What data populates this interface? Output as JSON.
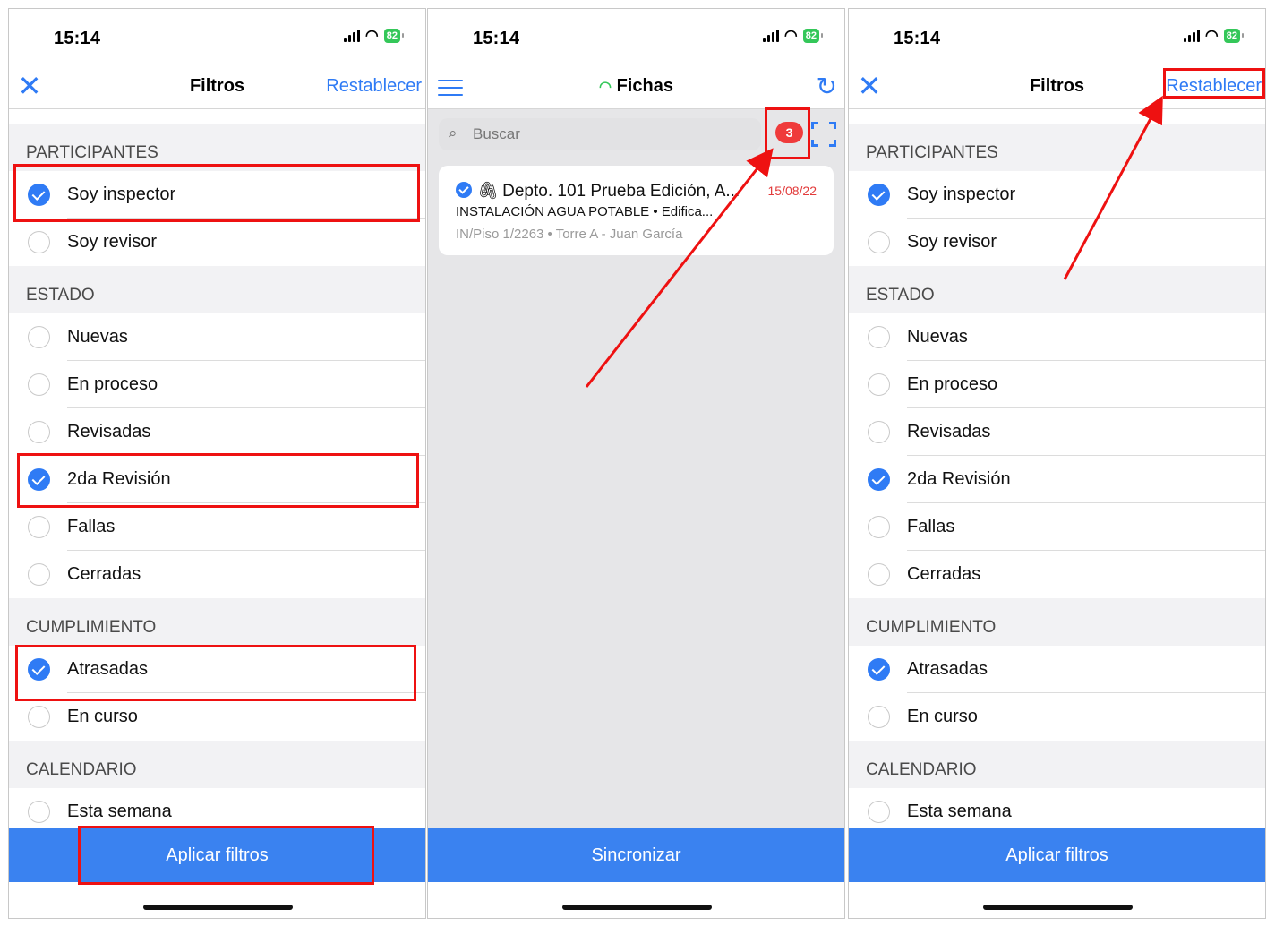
{
  "status_bar": {
    "time": "15:14",
    "battery": "82"
  },
  "filters_screen": {
    "close_icon": "close-icon",
    "title": "Filtros",
    "reset_label": "Restablecer",
    "sections": {
      "participants": "PARTICIPANTES",
      "state": "ESTADO",
      "compliance": "CUMPLIMIENTO",
      "calendar": "CALENDARIO"
    },
    "options": {
      "inspector": "Soy inspector",
      "reviewer": "Soy revisor",
      "new": "Nuevas",
      "in_process": "En proceso",
      "reviewed": "Revisadas",
      "second_review": "2da Revisión",
      "failures": "Fallas",
      "closed": "Cerradas",
      "overdue": "Atrasadas",
      "ongoing": "En curso",
      "this_week": "Esta semana"
    },
    "apply_label": "Aplicar filtros"
  },
  "list_screen": {
    "menu_icon": "menu-icon",
    "wifi_icon": "wifi-icon",
    "title": "Fichas",
    "sync_icon": "sync-icon",
    "search_placeholder": "Buscar",
    "filter_count": "3",
    "scan_icon": "scan-icon",
    "card": {
      "title": "Depto. 101 Prueba Edición, A...",
      "date": "15/08/22",
      "subtitle": "INSTALACIÓN AGUA POTABLE • Edifica...",
      "meta": "IN/Piso 1/2263 • Torre A - Juan García"
    },
    "sync_label": "Sincronizar"
  },
  "colors": {
    "accent": "#2f7bf5",
    "apply_bar": "#3a82f0",
    "highlight": "#ee1111",
    "badge": "#ef3b3b",
    "date": "#e23b3b"
  }
}
